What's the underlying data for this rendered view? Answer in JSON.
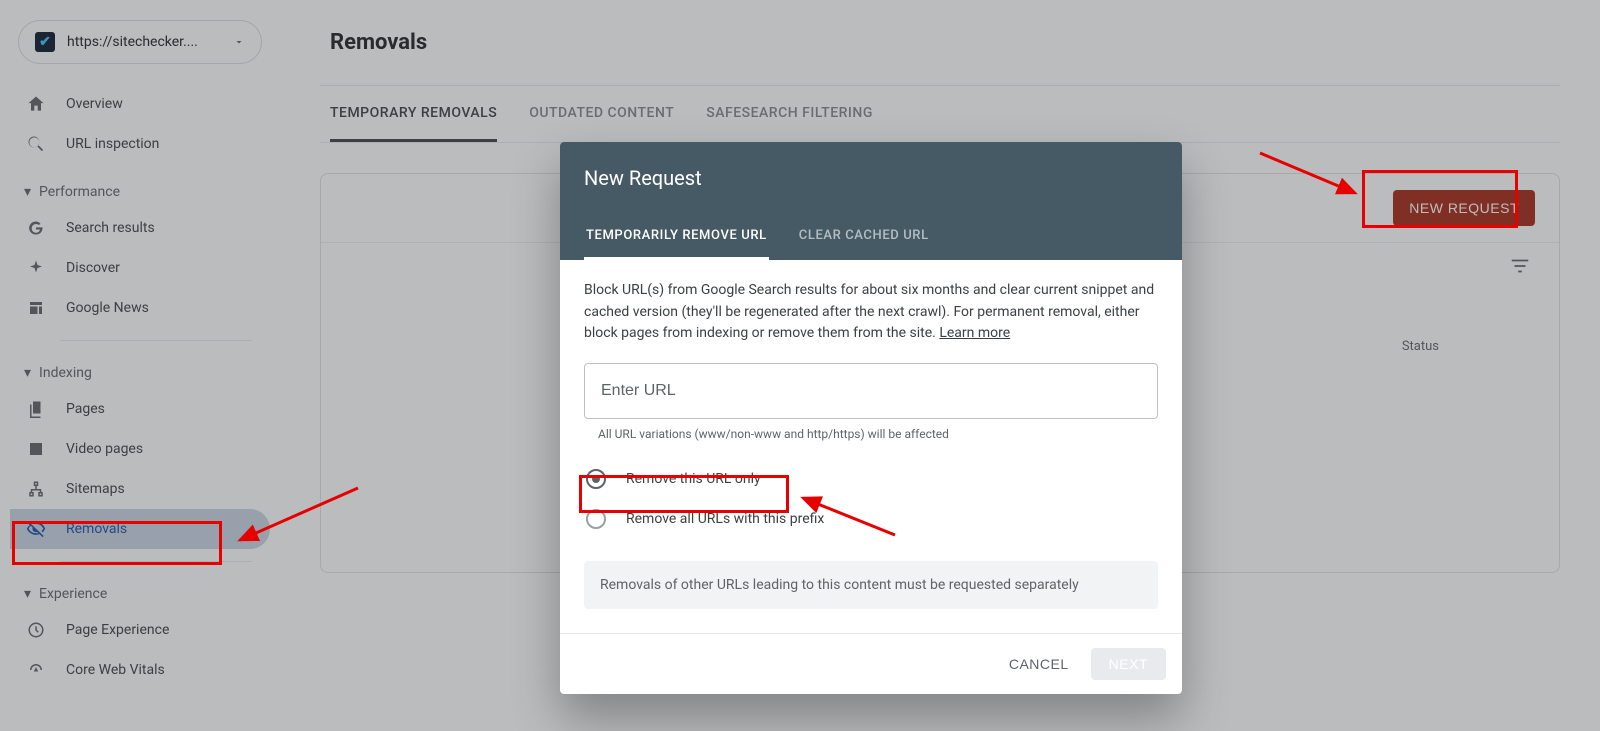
{
  "property_url": "https://sitechecker....",
  "sidebar": {
    "overview": "Overview",
    "url_inspection": "URL inspection",
    "sections": {
      "performance": "Performance",
      "indexing": "Indexing",
      "experience": "Experience"
    },
    "performance_items": {
      "search_results": "Search results",
      "discover": "Discover",
      "google_news": "Google News"
    },
    "indexing_items": {
      "pages": "Pages",
      "video_pages": "Video pages",
      "sitemaps": "Sitemaps",
      "removals": "Removals"
    },
    "experience_items": {
      "page_experience": "Page Experience",
      "core_web_vitals": "Core Web Vitals"
    }
  },
  "main": {
    "title": "Removals",
    "tabs": {
      "temp": "TEMPORARY REMOVALS",
      "outdated": "OUTDATED CONTENT",
      "safesearch": "SAFESEARCH FILTERING"
    },
    "new_request_btn": "NEW REQUEST",
    "table": {
      "status_header": "Status"
    }
  },
  "dialog": {
    "title": "New Request",
    "tabs": {
      "temp_remove": "TEMPORARILY REMOVE URL",
      "clear_cached": "CLEAR CACHED URL"
    },
    "description": "Block URL(s) from Google Search results for about six months and clear current snippet and cached version (they'll be regenerated after the next crawl). For permanent removal, either block pages from indexing or remove them from the site. ",
    "learn_more": "Learn more",
    "url_placeholder": "Enter URL",
    "helper": "All URL variations (www/non-www and http/https) will be affected",
    "radio_only": "Remove this URL only",
    "radio_prefix": "Remove all URLs with this prefix",
    "note": "Removals of other URLs leading to this content must be requested separately",
    "cancel": "CANCEL",
    "next": "NEXT"
  }
}
